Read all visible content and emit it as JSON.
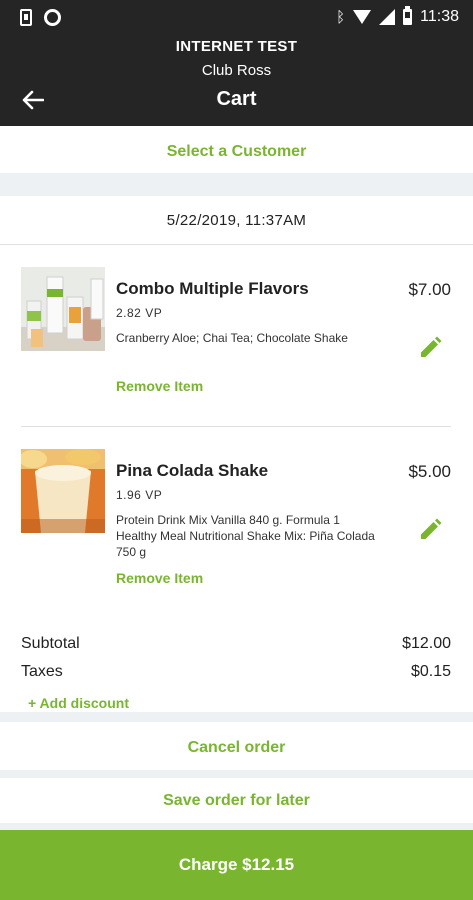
{
  "status_bar": {
    "time": "11:38",
    "icons": [
      "phone-icon",
      "circle-icon",
      "bluetooth-icon",
      "wifi-icon",
      "signal-icon",
      "battery-icon"
    ]
  },
  "header": {
    "store": "INTERNET TEST",
    "club": "Club Ross",
    "title": "Cart",
    "back_icon": "arrow-left"
  },
  "customer": {
    "select_label": "Select a Customer"
  },
  "order_datetime": "5/22/2019,  11:37AM",
  "items": [
    {
      "name": "Combo Multiple Flavors",
      "vp": "2.82 VP",
      "description": "Cranberry Aloe; Chai Tea; Chocolate Shake",
      "price": "$7.00",
      "remove_label": "Remove Item"
    },
    {
      "name": "Pina Colada Shake",
      "vp": "1.96 VP",
      "description": "Protein Drink Mix Vanilla 840 g.  Formula 1 Healthy Meal Nutritional Shake Mix: Piña Colada 750 g",
      "price": "$5.00",
      "remove_label": "Remove Item"
    }
  ],
  "summary": {
    "subtotal_label": "Subtotal",
    "subtotal_value": "$12.00",
    "taxes_label": "Taxes",
    "taxes_value": "$0.15",
    "add_discount_label": "+ Add discount"
  },
  "actions": {
    "cancel_label": "Cancel order",
    "save_label": "Save order for later",
    "charge_label": "Charge $12.15"
  },
  "colors": {
    "accent": "#7ab530",
    "header_bg": "#252525",
    "separator": "#eef1f4"
  }
}
